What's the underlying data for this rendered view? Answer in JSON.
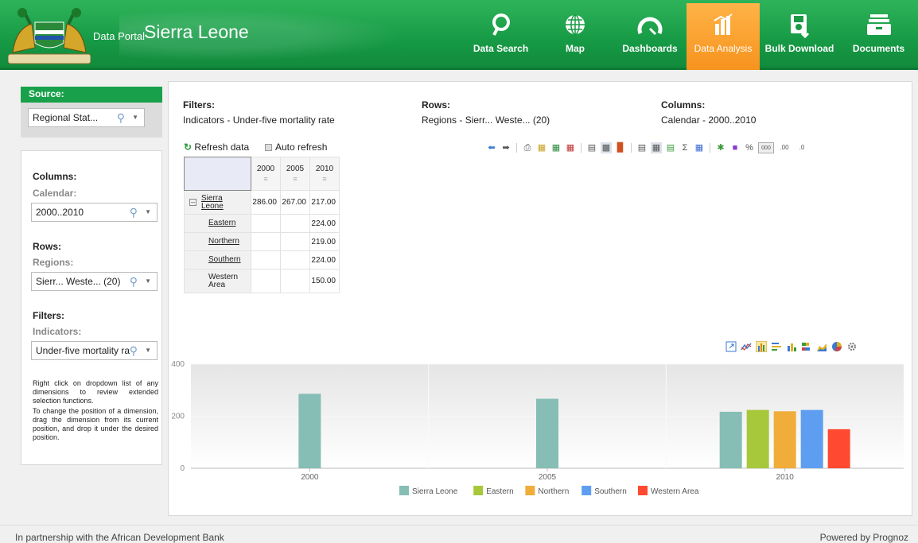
{
  "header": {
    "title_small": "Data Portal",
    "title_big": "Sierra Leone",
    "nav": [
      {
        "label": "Data Search",
        "icon": "magnifier-icon"
      },
      {
        "label": "Map",
        "icon": "globe-icon"
      },
      {
        "label": "Dashboards",
        "icon": "gauge-icon"
      },
      {
        "label": "Data Analysis",
        "icon": "bar-chart-icon",
        "active": true
      },
      {
        "label": "Bulk Download",
        "icon": "download-icon"
      },
      {
        "label": "Documents",
        "icon": "documents-icon"
      }
    ]
  },
  "sidebar": {
    "source_label": "Source:",
    "source_value": "Regional Stat...",
    "columns_label": "Columns:",
    "columns_dim": "Calendar:",
    "columns_value": "2000..2010",
    "rows_label": "Rows:",
    "rows_dim": "Regions:",
    "rows_value": "Sierr... Weste... (20)",
    "filters_label": "Filters:",
    "filters_dim": "Indicators:",
    "filters_value": "Under-five mortality ra",
    "help1": "Right click on dropdown list of any dimensions to review extended selection functions.",
    "help2": "To change the position of a dimension, drag the dimension from its current position, and drop it under the desired position."
  },
  "summary": {
    "filters_label": "Filters:",
    "filters_value": "Indicators - Under-five mortality rate",
    "rows_label": "Rows:",
    "rows_value": "Regions - Sierr... Weste... (20)",
    "columns_label": "Columns:",
    "columns_value": "Calendar - 2000..2010"
  },
  "controls": {
    "refresh_label": "Refresh data",
    "auto_refresh_label": "Auto refresh"
  },
  "table": {
    "columns": [
      "2000",
      "2005",
      "2010"
    ],
    "rows": [
      {
        "label": "Sierra Leone",
        "values": [
          "286.00",
          "267.00",
          "217.00"
        ]
      },
      {
        "label": "Eastern",
        "values": [
          "",
          "",
          "224.00"
        ]
      },
      {
        "label": "Northern",
        "values": [
          "",
          "",
          "219.00"
        ]
      },
      {
        "label": "Southern",
        "values": [
          "",
          "",
          "224.00"
        ]
      },
      {
        "label": "Western Area",
        "values": [
          "",
          "",
          "150.00"
        ]
      }
    ]
  },
  "chart_data": {
    "type": "bar",
    "categories": [
      "2000",
      "2005",
      "2010"
    ],
    "series": [
      {
        "name": "Sierra Leone",
        "color": "#86bdb5",
        "values": [
          286,
          267,
          217
        ]
      },
      {
        "name": "Eastern",
        "color": "#a6c83a",
        "values": [
          null,
          null,
          224
        ]
      },
      {
        "name": "Northern",
        "color": "#f0ad3a",
        "values": [
          null,
          null,
          219
        ]
      },
      {
        "name": "Southern",
        "color": "#5e9ef0",
        "values": [
          null,
          null,
          224
        ]
      },
      {
        "name": "Western Area",
        "color": "#ff4a31",
        "values": [
          null,
          null,
          150
        ]
      }
    ],
    "yticks": [
      "0",
      "200",
      "400"
    ],
    "ylim": [
      0,
      400
    ],
    "legend": "bottom"
  },
  "footer": {
    "left": "In partnership with the African Development Bank",
    "right": "Powered by Prognoz"
  }
}
